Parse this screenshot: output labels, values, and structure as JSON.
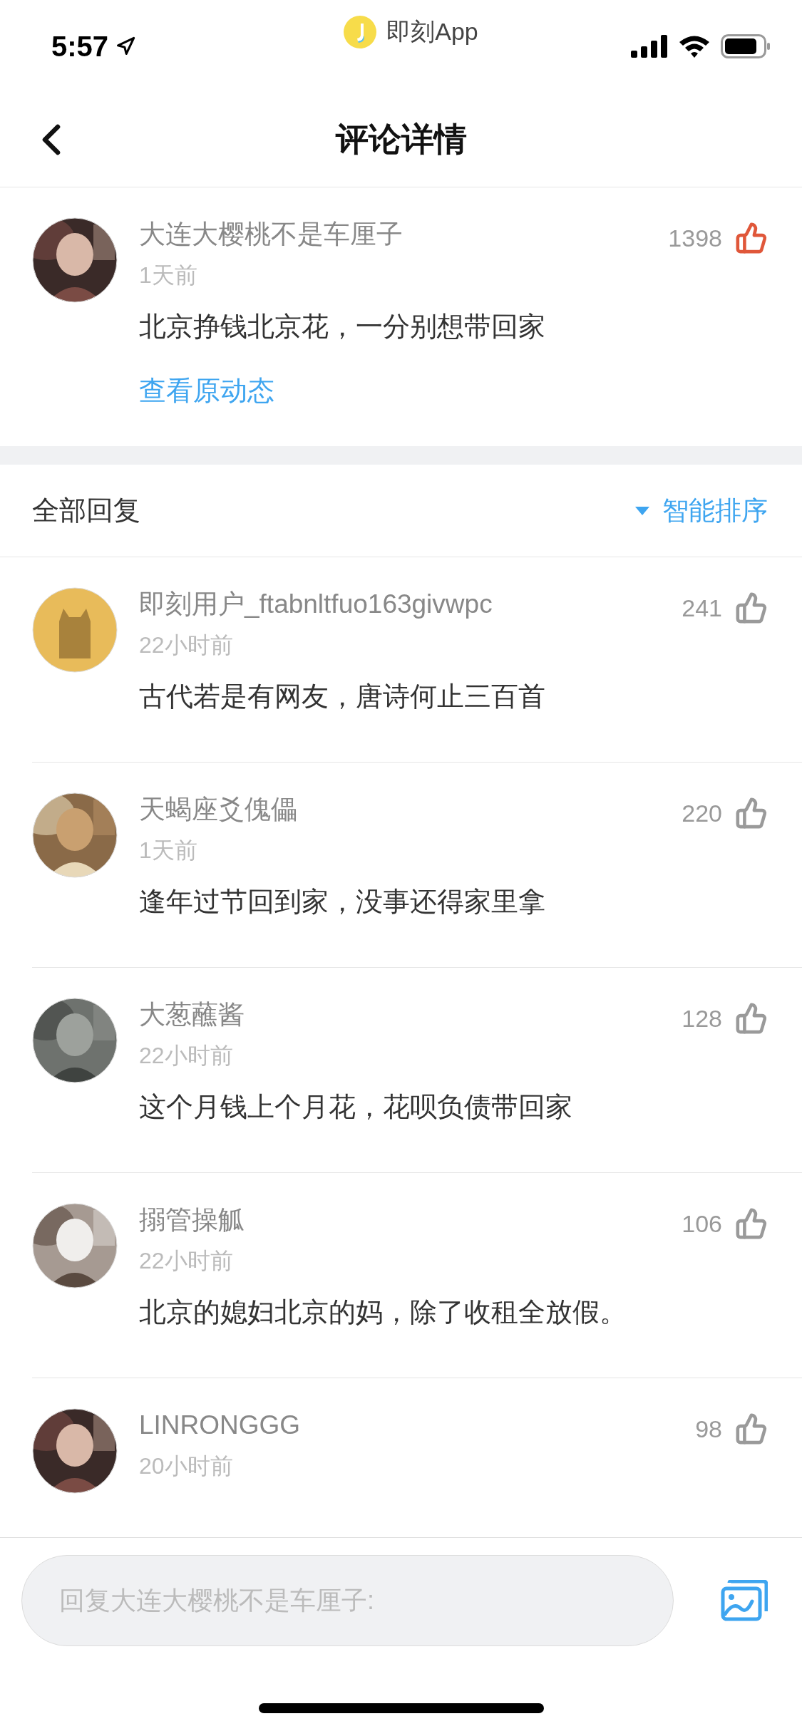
{
  "status_bar": {
    "time": "5:57",
    "app_label": "即刻App"
  },
  "nav": {
    "title": "评论详情"
  },
  "main_comment": {
    "author": "大连大樱桃不是车厘子",
    "time": "1天前",
    "likes": "1398",
    "liked": true,
    "text": "北京挣钱北京花，一分别想带回家",
    "link": "查看原动态"
  },
  "replies_header": {
    "title": "全部回复",
    "sort": "智能排序"
  },
  "replies": [
    {
      "author": "即刻用户_ftabnltfuo163givwpc",
      "time": "22小时前",
      "likes": "241",
      "liked": false,
      "text": "古代若是有网友，唐诗何止三百首",
      "avatar": {
        "kind": "default"
      }
    },
    {
      "author": "天蝎座爻傀儡",
      "time": "1天前",
      "likes": "220",
      "liked": false,
      "text": "逢年过节回到家，没事还得家里拿"
    },
    {
      "author": "大葱蘸酱",
      "time": "22小时前",
      "likes": "128",
      "liked": false,
      "text": "这个月钱上个月花，花呗负债带回家"
    },
    {
      "author": "搦管操觚",
      "time": "22小时前",
      "likes": "106",
      "liked": false,
      "text": "北京的媳妇北京的妈，除了收租全放假。"
    },
    {
      "author": "LINRONGGG",
      "time": "20小时前",
      "likes": "98",
      "liked": false
    }
  ],
  "reply_bar": {
    "placeholder": "回复大连大樱桃不是车厘子:"
  }
}
